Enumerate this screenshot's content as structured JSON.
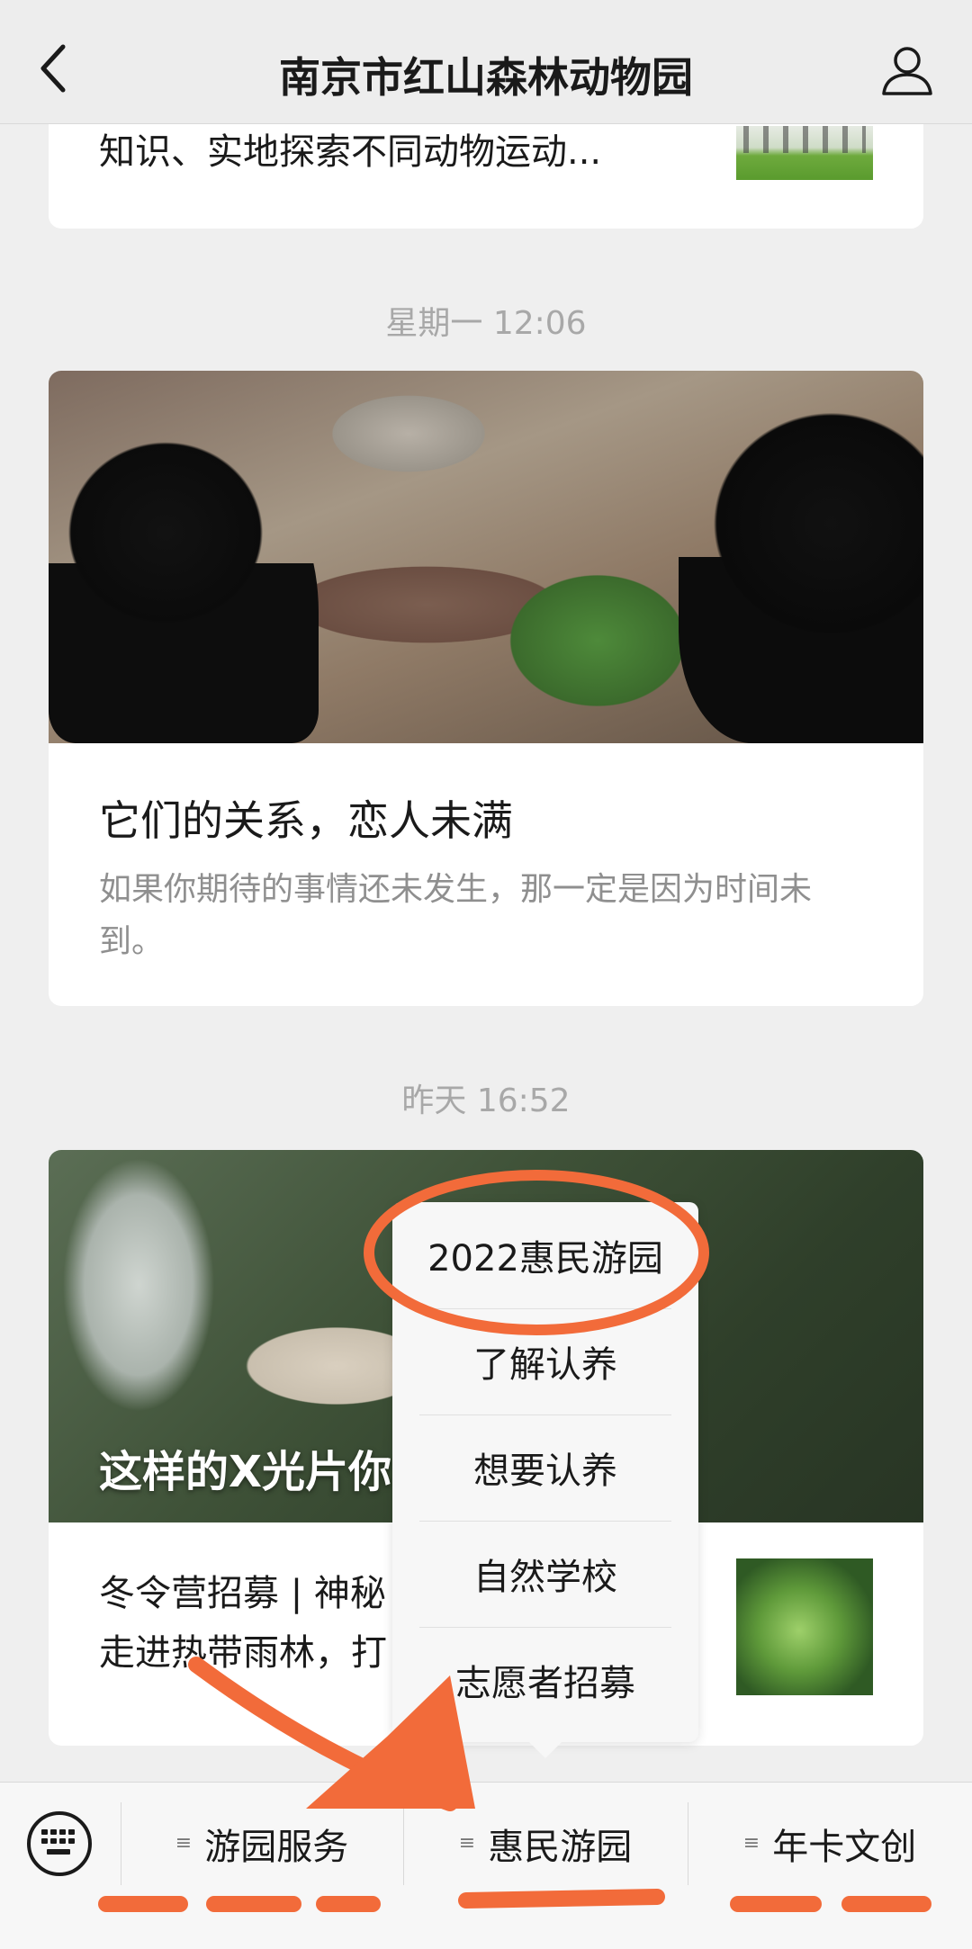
{
  "navbar": {
    "title": "南京市红山森林动物园",
    "back_icon": "chevron-left-icon",
    "profile_icon": "person-icon"
  },
  "feed": {
    "previous_card": {
      "text": "知识、实地探索不同动物运动..."
    },
    "timestamp_1": "星期一 12:06",
    "card_1": {
      "headline": "它们的关系，恋人未满",
      "summary": "如果你期待的事情还未发生，那一定是因为时间未到。"
    },
    "timestamp_2": "昨天 16:52",
    "card_2": {
      "image_title": "这样的X光片你",
      "story": "冬令营招募 | 神秘\n走进热带雨林，打"
    }
  },
  "popup_menu": {
    "items": [
      "2022惠民游园",
      "了解认养",
      "想要认养",
      "自然学校",
      "志愿者招募"
    ]
  },
  "bottom_menu": {
    "keyboard_icon": "keyboard-icon",
    "buttons": [
      "游园服务",
      "惠民游园",
      "年卡文创"
    ],
    "menu_lines_icon": "≡"
  },
  "colors": {
    "annotation": "#f26b3a",
    "background": "#efefef",
    "card": "#ffffff"
  }
}
